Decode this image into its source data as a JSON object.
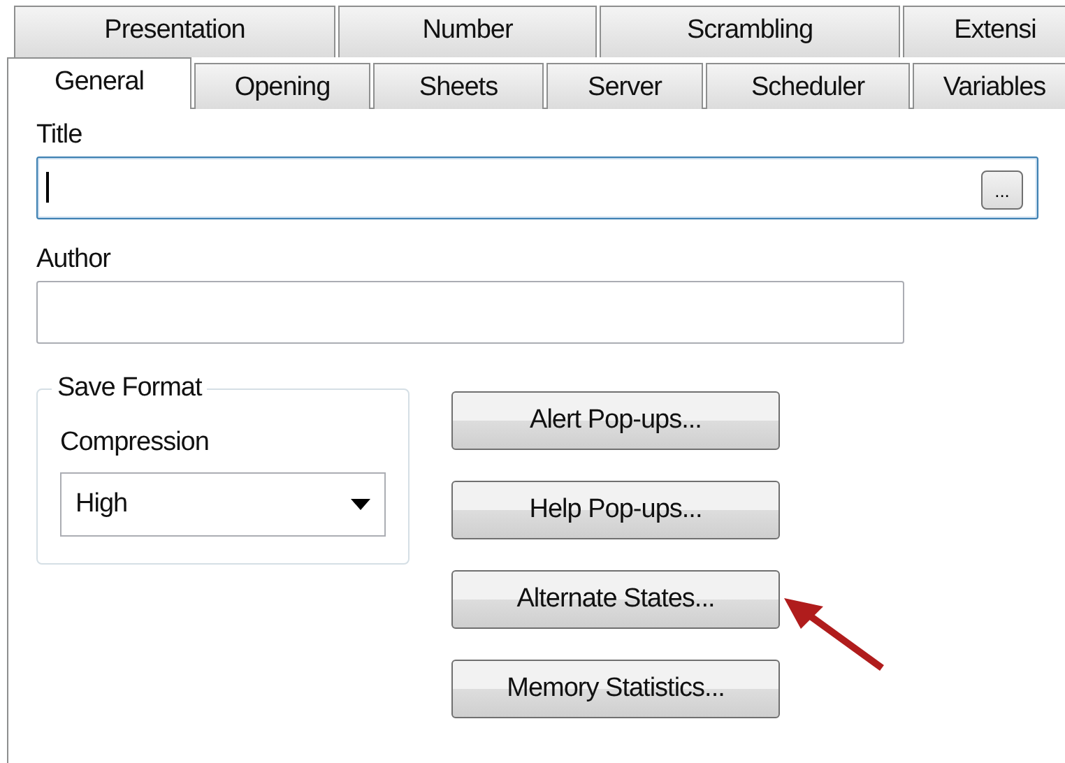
{
  "tab_rows": [
    [
      {
        "label": "Presentation",
        "selected": false
      },
      {
        "label": "Number",
        "selected": false
      },
      {
        "label": "Scrambling",
        "selected": false
      },
      {
        "label": "Extensi",
        "selected": false
      }
    ],
    [
      {
        "label": "General",
        "selected": true
      },
      {
        "label": "Opening",
        "selected": false
      },
      {
        "label": "Sheets",
        "selected": false
      },
      {
        "label": "Server",
        "selected": false
      },
      {
        "label": "Scheduler",
        "selected": false
      },
      {
        "label": "Variables",
        "selected": false
      }
    ]
  ],
  "title": {
    "label": "Title",
    "browse_button": "...",
    "focused": true
  },
  "author": {
    "label": "Author"
  },
  "save_format": {
    "legend": "Save Format",
    "compression_label": "Compression",
    "compression_value": "High"
  },
  "buttons": [
    {
      "label": "Alert Pop-ups...",
      "highlighted": false
    },
    {
      "label": "Help Pop-ups...",
      "highlighted": false
    },
    {
      "label": "Alternate States...",
      "highlighted": true
    },
    {
      "label": "Memory Statistics...",
      "highlighted": false
    }
  ]
}
